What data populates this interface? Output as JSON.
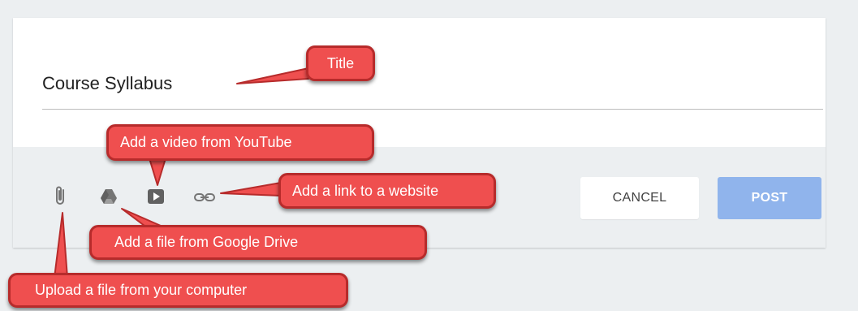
{
  "post": {
    "title_value": "Course Syllabus"
  },
  "toolbar": {
    "icons": [
      "paperclip-icon",
      "google-drive-icon",
      "youtube-icon",
      "link-icon"
    ],
    "cancel_label": "CANCEL",
    "post_label": "POST"
  },
  "annotations": {
    "title": "Title",
    "youtube": "Add a video from YouTube",
    "link": "Add a link to a website",
    "drive": "Add a file from Google Drive",
    "upload": "Upload a file from your computer"
  },
  "colors": {
    "post_button": "#90b4ec",
    "callout_fill": "#ef4f4f",
    "callout_border": "#b72b2b",
    "toolbar_bg": "#eceff1",
    "background": "#eceff1"
  }
}
